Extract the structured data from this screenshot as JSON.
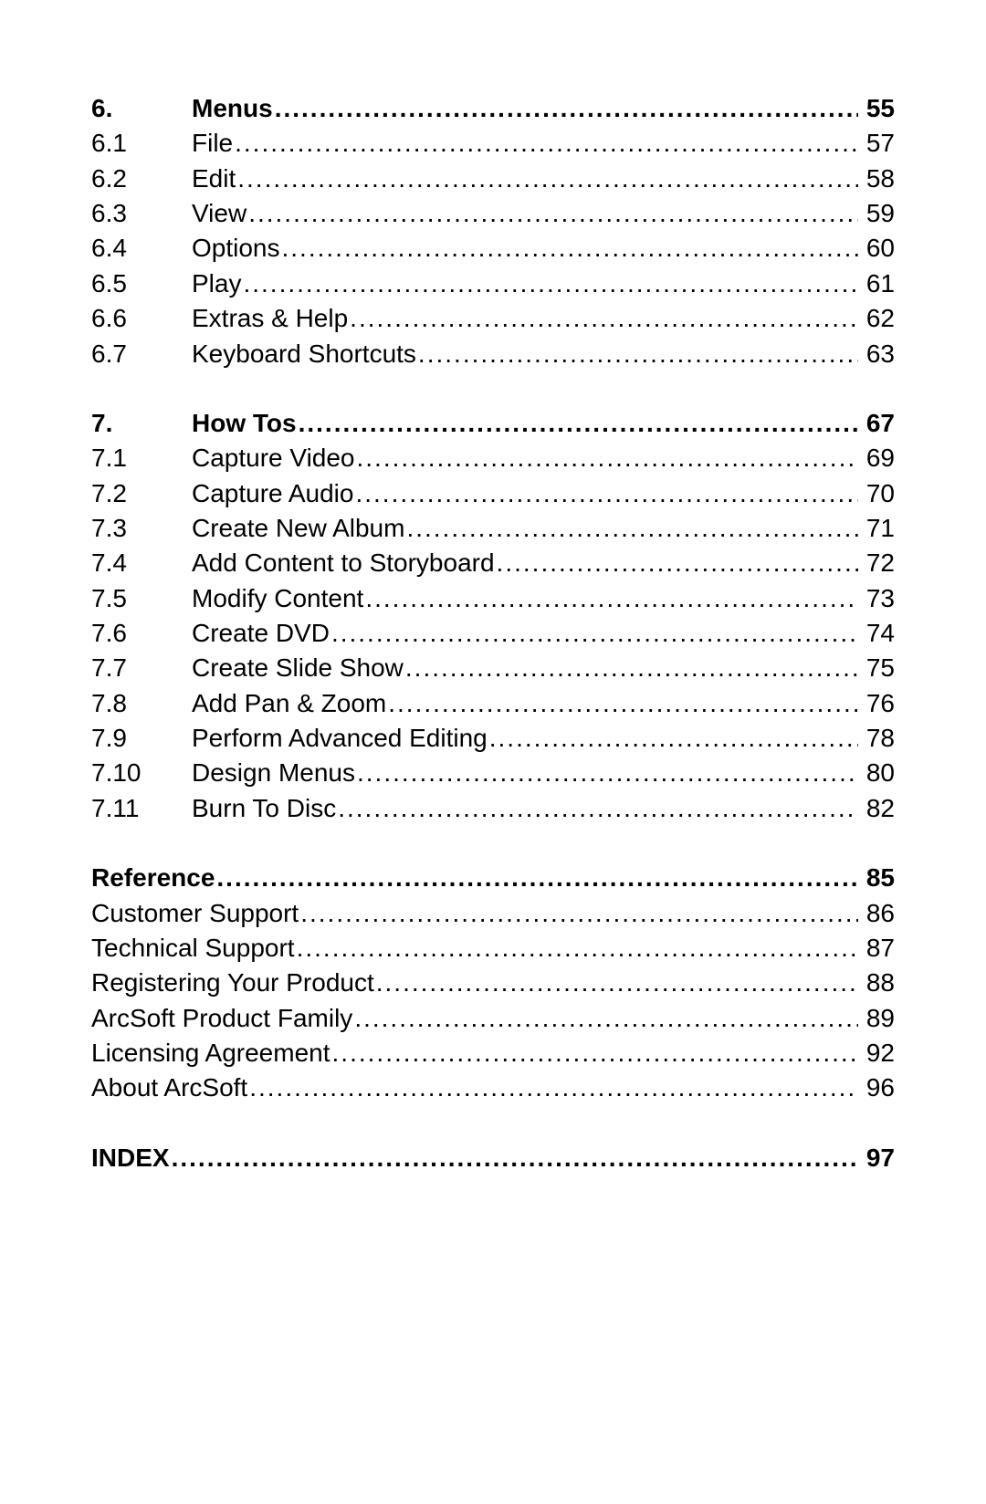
{
  "sections": [
    {
      "heading": {
        "num": "6.",
        "title": "Menus",
        "page": "55"
      },
      "entries": [
        {
          "num": "6.1",
          "title": "File",
          "page": "57"
        },
        {
          "num": "6.2",
          "title": "Edit",
          "page": "58"
        },
        {
          "num": "6.3",
          "title": "View",
          "page": "59"
        },
        {
          "num": "6.4",
          "title": "Options",
          "page": "60"
        },
        {
          "num": "6.5",
          "title": "Play",
          "page": "61"
        },
        {
          "num": "6.6",
          "title": "Extras & Help",
          "page": "62"
        },
        {
          "num": "6.7",
          "title": "Keyboard Shortcuts",
          "page": "63"
        }
      ]
    },
    {
      "heading": {
        "num": "7.",
        "title": "How Tos",
        "page": "67"
      },
      "entries": [
        {
          "num": "7.1",
          "title": "Capture Video",
          "page": "69"
        },
        {
          "num": "7.2",
          "title": "Capture Audio",
          "page": "70"
        },
        {
          "num": "7.3",
          "title": "Create New Album",
          "page": "71"
        },
        {
          "num": "7.4",
          "title": "Add Content to Storyboard",
          "page": "72"
        },
        {
          "num": "7.5",
          "title": "Modify Content",
          "page": "73"
        },
        {
          "num": "7.6",
          "title": "Create DVD",
          "page": "74"
        },
        {
          "num": "7.7",
          "title": "Create Slide Show",
          "page": "75"
        },
        {
          "num": "7.8",
          "title": "Add Pan & Zoom",
          "page": "76"
        },
        {
          "num": "7.9",
          "title": "Perform Advanced Editing",
          "page": "78"
        },
        {
          "num": "7.10",
          "title": "Design Menus",
          "page": "80"
        },
        {
          "num": "7.11",
          "title": "Burn To Disc",
          "page": "82"
        }
      ]
    },
    {
      "heading": {
        "num": "",
        "title": "Reference",
        "page": "85"
      },
      "entries": [
        {
          "num": "",
          "title": "Customer Support",
          "page": "86"
        },
        {
          "num": "",
          "title": "Technical Support",
          "page": "87"
        },
        {
          "num": "",
          "title": "Registering Your Product",
          "page": "88"
        },
        {
          "num": "",
          "title": "ArcSoft Product Family",
          "page": "89"
        },
        {
          "num": "",
          "title": "Licensing Agreement",
          "page": "92"
        },
        {
          "num": "",
          "title": "About ArcSoft",
          "page": "96"
        }
      ]
    },
    {
      "heading": {
        "num": "",
        "title": "INDEX",
        "page": "97"
      },
      "entries": []
    }
  ]
}
